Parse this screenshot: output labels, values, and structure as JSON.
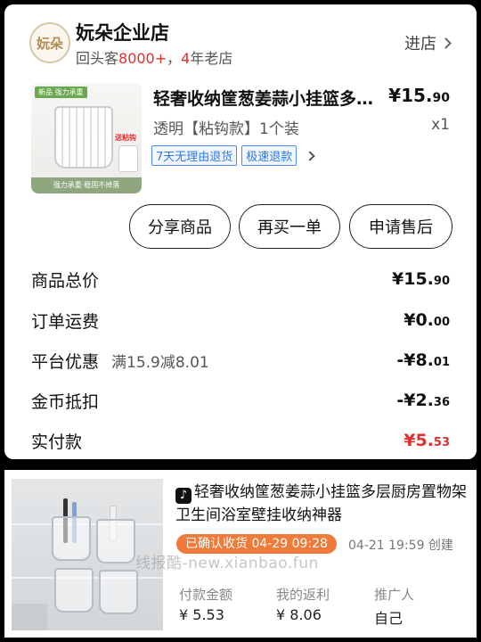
{
  "order": {
    "store": {
      "logo_text": "妧朵",
      "name": "妧朵企业店",
      "sub_prefix": "回头客",
      "sub_count": "8000+",
      "sub_sep": "，",
      "sub_years": "4",
      "sub_suffix": "年老店",
      "enter_label": "进店"
    },
    "product": {
      "image_badge": "新品 强力承重",
      "image_hook_label": "送粘钩",
      "image_footer": "强力承重·稳固不掉落",
      "title": "轻奢收纳筐葱姜蒜小挂篮多层厨房置物架卫生间浴室壁挂收纳神器",
      "price_main": "¥15.",
      "price_dec": "90",
      "spec": "透明【粘钩款】1个装",
      "qty": "x1",
      "tags": [
        "7天无理由退货",
        "极速退款"
      ]
    },
    "actions": {
      "share": "分享商品",
      "rebuy": "再买一单",
      "after_sale": "申请售后"
    },
    "summary": {
      "total_label": "商品总价",
      "total_main": "¥15.",
      "total_dec": "90",
      "shipping_label": "订单运费",
      "shipping_main": "¥0.",
      "shipping_dec": "00",
      "discount_label": "平台优惠",
      "discount_note": "满15.9减8.01",
      "discount_main": "-¥8.",
      "discount_dec": "01",
      "coin_label": "金币抵扣",
      "coin_main": "-¥2.",
      "coin_dec": "36",
      "paid_label": "实付款",
      "paid_main": "¥5.",
      "paid_dec": "53"
    }
  },
  "rebate": {
    "platform_icon": "♪",
    "title": "轻奢收纳筐葱姜蒜小挂篮多层厨房置物架卫生间浴室壁挂收纳神器",
    "status": "已确认收货 04-29 09:28",
    "created": "04-21 19:59 创建",
    "watermark": "线报酷-new.xianbao.fun",
    "paid_label": "付款金额",
    "paid_value": "¥ 5.53",
    "rebate_label": "我的返利",
    "rebate_value": "¥ 8.06",
    "promoter_label": "推广人",
    "promoter_value": "自己"
  },
  "colors": {
    "accent_red": "#e0302c",
    "tag_blue": "#2d77e8",
    "status_orange": "#f07a3a"
  }
}
